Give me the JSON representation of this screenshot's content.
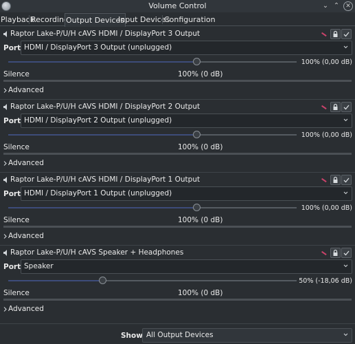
{
  "window": {
    "title": "Volume Control"
  },
  "tabs": [
    {
      "label": "Playback"
    },
    {
      "label": "Recording"
    },
    {
      "label": "Output Devices"
    },
    {
      "label": "Input Devices"
    },
    {
      "label": "Configuration"
    }
  ],
  "devices": [
    {
      "name": "Raptor Lake-P/U/H cAVS HDMI / DisplayPort 3 Output",
      "port_label": "Port:",
      "port_value": "HDMI / DisplayPort 3 Output (unplugged)",
      "volume_percent": 100,
      "volume_text": "100% (0,00 dB)",
      "silence_label": "Silence",
      "reference_label": "100% (0 dB)",
      "advanced_label": "Advanced",
      "muted": true,
      "locked": true
    },
    {
      "name": "Raptor Lake-P/U/H cAVS HDMI / DisplayPort 2 Output",
      "port_label": "Port:",
      "port_value": "HDMI / DisplayPort 2 Output (unplugged)",
      "volume_percent": 100,
      "volume_text": "100% (0,00 dB)",
      "silence_label": "Silence",
      "reference_label": "100% (0 dB)",
      "advanced_label": "Advanced",
      "muted": true,
      "locked": true
    },
    {
      "name": "Raptor Lake-P/U/H cAVS HDMI / DisplayPort 1 Output",
      "port_label": "Port:",
      "port_value": "HDMI / DisplayPort 1 Output (unplugged)",
      "volume_percent": 100,
      "volume_text": "100% (0,00 dB)",
      "silence_label": "Silence",
      "reference_label": "100% (0 dB)",
      "advanced_label": "Advanced",
      "muted": true,
      "locked": true
    },
    {
      "name": "Raptor Lake-P/U/H cAVS Speaker + Headphones",
      "port_label": "Port:",
      "port_value": "Speaker",
      "volume_percent": 50,
      "volume_text": "50% (-18,06 dB)",
      "silence_label": "Silence",
      "reference_label": "100% (0 dB)",
      "advanced_label": "Advanced",
      "muted": true,
      "locked": true
    }
  ],
  "footer": {
    "show_label": "Show:",
    "show_value": "All Output Devices"
  },
  "colors": {
    "background": "#2a2e32",
    "panel": "#31363b",
    "slider_fill": "#3d4c7a",
    "mute_indicator": "#c9426a"
  },
  "icons": {
    "app": "volume-control-icon",
    "window_controls": [
      "minimize-icon",
      "maximize-icon",
      "close-icon"
    ],
    "device": "speaker-icon",
    "device_buttons": [
      "mute-icon",
      "lock-icon",
      "check-icon"
    ],
    "select": "chevron-down-icon",
    "advanced": "chevron-right-icon"
  }
}
